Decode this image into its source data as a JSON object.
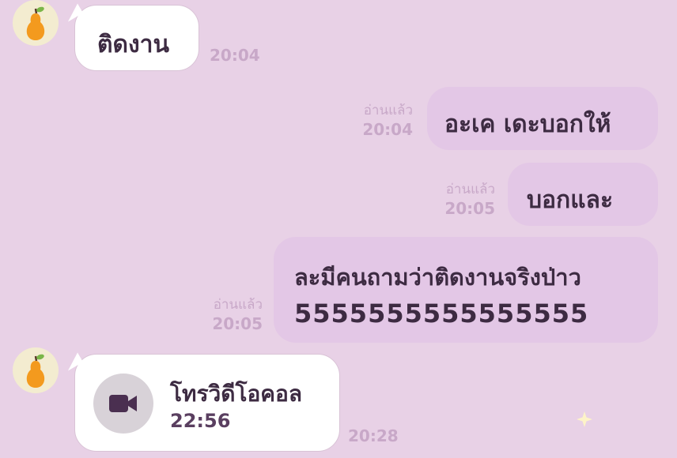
{
  "colors": {
    "background": "#e8d1e6",
    "incoming_bubble": "#ffffff",
    "outgoing_bubble": "#e3c7e6",
    "meta_text": "#c8a8c8",
    "message_text": "#3d2b42"
  },
  "contact": {
    "avatar_icon": "pear-icon"
  },
  "messages": [
    {
      "direction": "in",
      "text": "ติดงาน",
      "time": "20:04"
    },
    {
      "direction": "out",
      "text": "อะเค เดะบอกให้",
      "read": "อ่านแล้ว",
      "time": "20:04"
    },
    {
      "direction": "out",
      "text": "บอกและ",
      "read": "อ่านแล้ว",
      "time": "20:05"
    },
    {
      "direction": "out",
      "line1": "ละมีคนถามว่าติดงานจริงป่าว",
      "line2": "5555555555555555",
      "read": "อ่านแล้ว",
      "time": "20:05"
    }
  ],
  "video_call": {
    "icon": "video-camera-icon",
    "title": "โทรวิดีโอคอล",
    "duration": "22:56",
    "time": "20:28"
  }
}
